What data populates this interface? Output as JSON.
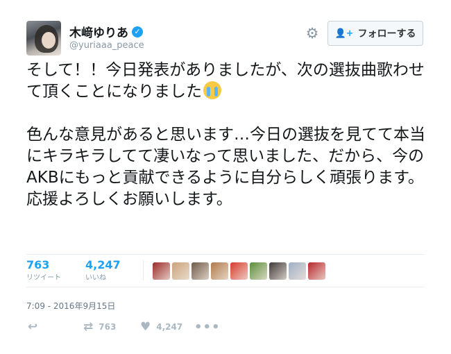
{
  "user": {
    "display_name": "木﨑ゆりあ",
    "verified_icon": "verified-badge-icon",
    "handle": "@yuriaaa_peace"
  },
  "header": {
    "settings_icon": "gear-icon",
    "follow_label": "フォローする",
    "follow_icon": "add-user-icon"
  },
  "tweet": {
    "paragraph1": "そして！！今日発表がありましたが、次の選抜曲歌わせて頂くことになりました",
    "paragraph1_emoji": "loudly-crying-face",
    "paragraph2": "色んな意見があると思います…今日の選抜を見てて本当にキラキラしてて凄いなって思いました、だから、今のAKBにもっと貢献できるように自分らしく頑張ります。応援よろしくお願いします。"
  },
  "stats": {
    "retweets": {
      "count": "763",
      "label": "リツイート"
    },
    "likes": {
      "count": "4,247",
      "label": "いいね"
    }
  },
  "likers": {
    "count_shown": 9,
    "colors": [
      "#9c2b2b",
      "#c9a27a",
      "#6f5a48",
      "#b07a4a",
      "#d83a2e",
      "#5b8f3a",
      "#3e3b39",
      "#9fb0c4",
      "#b8282e"
    ]
  },
  "timestamp": "7:09 - 2016年9月15日",
  "actions": {
    "reply_icon": "reply-icon",
    "retweet_icon": "retweet-icon",
    "retweet_count": "763",
    "like_icon": "heart-icon",
    "like_count": "4,247",
    "more_icon": "more-dots-icon"
  },
  "colors": {
    "accent": "#1da1f2",
    "text": "#14171a",
    "muted": "#8899a6",
    "border": "#e6ecf0"
  }
}
